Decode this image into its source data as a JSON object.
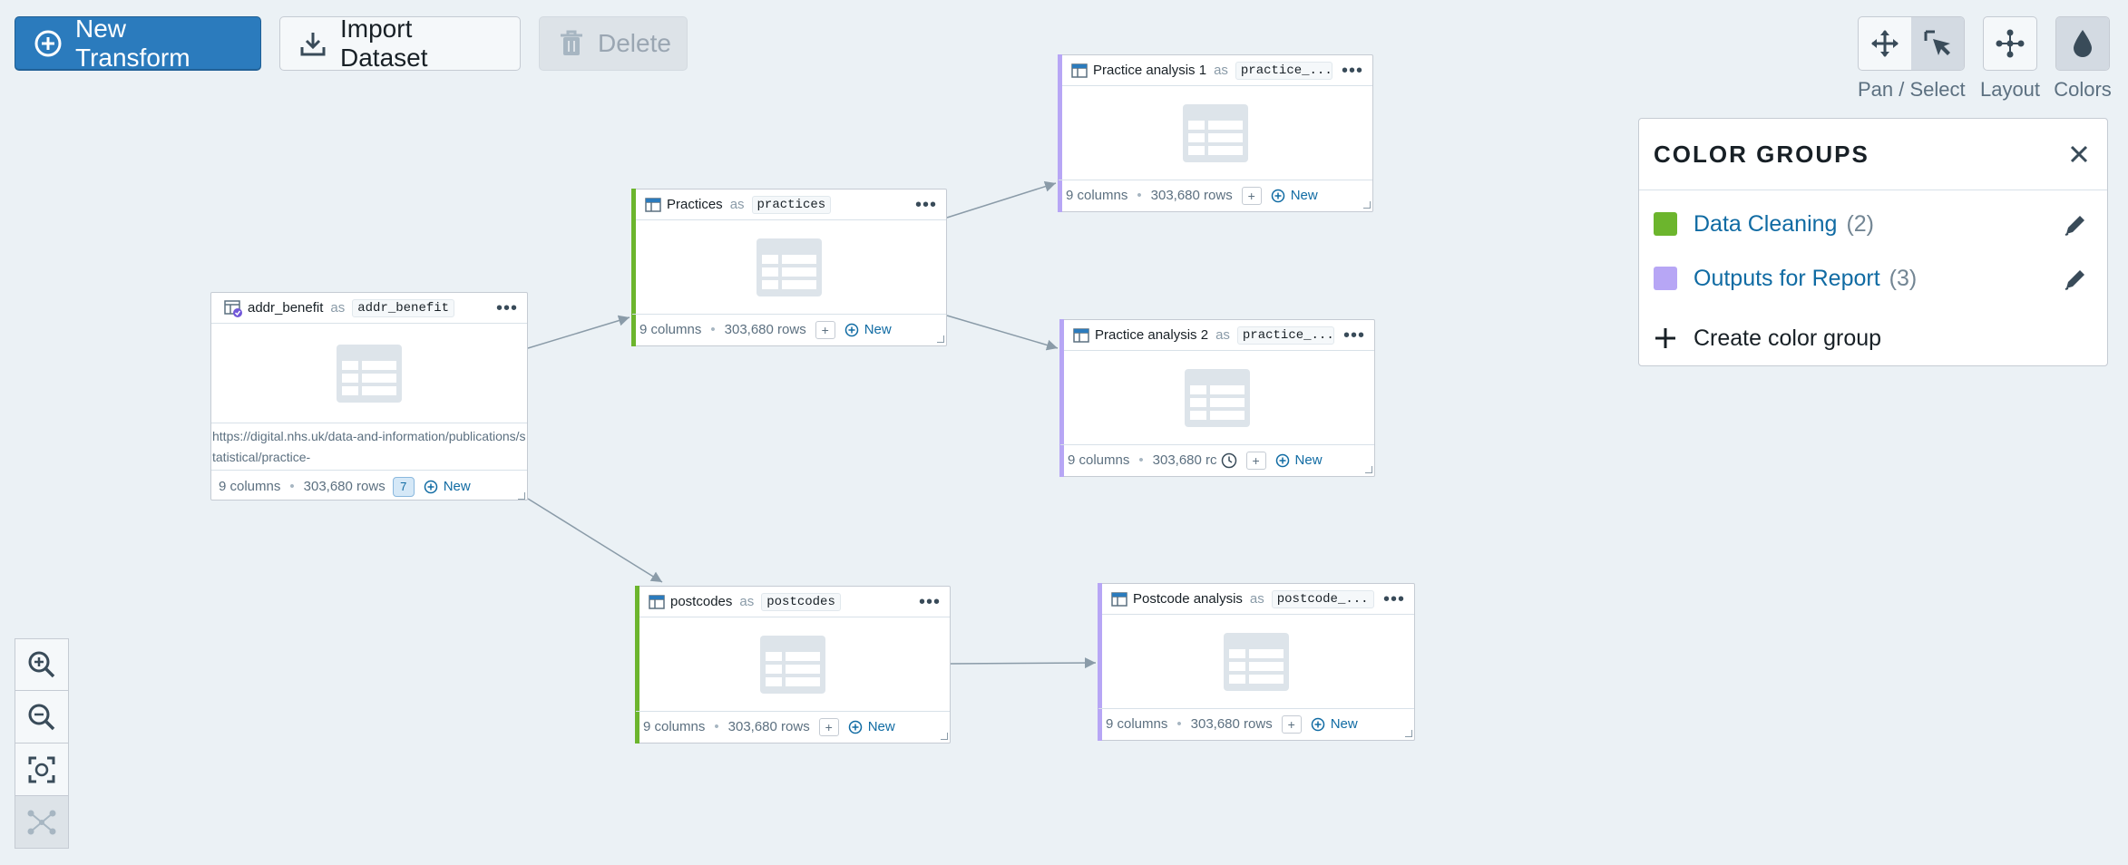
{
  "toolbar": {
    "new_transform": "New Transform",
    "import_dataset": "Import Dataset",
    "delete": "Delete"
  },
  "right_toolbar": {
    "pan_select": "Pan / Select",
    "layout": "Layout",
    "colors": "Colors"
  },
  "color_groups": {
    "title": "COLOR GROUPS",
    "groups": [
      {
        "name": "Data Cleaning",
        "count": "(2)",
        "color": "#6cb52d"
      },
      {
        "name": "Outputs for Report",
        "count": "(3)",
        "color": "#b7a6f5"
      }
    ],
    "create": "Create color group"
  },
  "nodes": {
    "addr_benefit": {
      "name": "addr_benefit",
      "as": "as",
      "alias": "addr_benefit",
      "description": "https://digital.nhs.uk/data-and-information/publications/statistical/practice-",
      "columns": "9 columns",
      "rows": "303,680 rows",
      "badge": "7",
      "new": "New"
    },
    "practices": {
      "name": "Practices",
      "as": "as",
      "alias": "practices",
      "columns": "9 columns",
      "rows": "303,680 rows",
      "plus": "+",
      "new": "New",
      "color": "#6cb52d"
    },
    "postcodes": {
      "name": "postcodes",
      "as": "as",
      "alias": "postcodes",
      "columns": "9 columns",
      "rows": "303,680 rows",
      "plus": "+",
      "new": "New",
      "color": "#6cb52d"
    },
    "practice_analysis_1": {
      "name": "Practice analysis 1",
      "as": "as",
      "alias": "practice_...",
      "columns": "9 columns",
      "rows": "303,680 rows",
      "plus": "+",
      "new": "New",
      "color": "#b7a6f5"
    },
    "practice_analysis_2": {
      "name": "Practice analysis 2",
      "as": "as",
      "alias": "practice_...",
      "columns": "9 columns",
      "rows": "303,680 rc",
      "plus": "+",
      "new": "New",
      "color": "#b7a6f5"
    },
    "postcode_analysis": {
      "name": "Postcode analysis",
      "as": "as",
      "alias": "postcode_...",
      "columns": "9 columns",
      "rows": "303,680 rows",
      "plus": "+",
      "new": "New",
      "color": "#b7a6f5"
    }
  },
  "node_menu": "•••",
  "separator_dot": "•"
}
